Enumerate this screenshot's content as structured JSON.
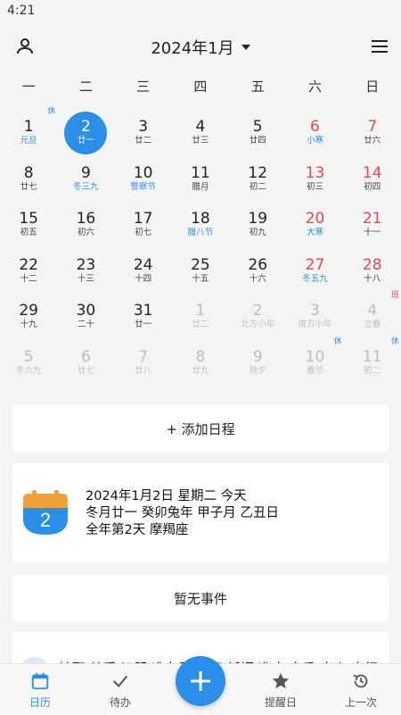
{
  "status": {
    "time": "4:21"
  },
  "header": {
    "title": "2024年1月"
  },
  "weekdays": [
    "一",
    "二",
    "三",
    "四",
    "五",
    "六",
    "日"
  ],
  "calendar": {
    "rows": [
      [
        {
          "n": "1",
          "s": "元旦",
          "f": true,
          "b": "休",
          "bt": "rest"
        },
        {
          "n": "2",
          "s": "廿一",
          "sel": true
        },
        {
          "n": "3",
          "s": "廿二"
        },
        {
          "n": "4",
          "s": "廿三"
        },
        {
          "n": "5",
          "s": "廿四"
        },
        {
          "n": "6",
          "s": "小寒",
          "f": true,
          "w": true
        },
        {
          "n": "7",
          "s": "廿六",
          "w": true
        }
      ],
      [
        {
          "n": "8",
          "s": "廿七"
        },
        {
          "n": "9",
          "s": "冬三九",
          "f": true
        },
        {
          "n": "10",
          "s": "警察节",
          "f": true
        },
        {
          "n": "11",
          "s": "腊月"
        },
        {
          "n": "12",
          "s": "初二"
        },
        {
          "n": "13",
          "s": "初三",
          "w": true
        },
        {
          "n": "14",
          "s": "初四",
          "w": true
        }
      ],
      [
        {
          "n": "15",
          "s": "初五"
        },
        {
          "n": "16",
          "s": "初六"
        },
        {
          "n": "17",
          "s": "初七"
        },
        {
          "n": "18",
          "s": "腊八节",
          "f": true
        },
        {
          "n": "19",
          "s": "初九"
        },
        {
          "n": "20",
          "s": "大寒",
          "f": true,
          "w": true
        },
        {
          "n": "21",
          "s": "十一",
          "w": true
        }
      ],
      [
        {
          "n": "22",
          "s": "十二"
        },
        {
          "n": "23",
          "s": "十三"
        },
        {
          "n": "24",
          "s": "十四"
        },
        {
          "n": "25",
          "s": "十五"
        },
        {
          "n": "26",
          "s": "十六"
        },
        {
          "n": "27",
          "s": "冬五九",
          "f": true,
          "w": true
        },
        {
          "n": "28",
          "s": "十八",
          "w": true
        }
      ],
      [
        {
          "n": "29",
          "s": "十九"
        },
        {
          "n": "30",
          "s": "二十"
        },
        {
          "n": "31",
          "s": "廿一"
        },
        {
          "n": "1",
          "s": "廿二",
          "o": true
        },
        {
          "n": "2",
          "s": "北方小年",
          "o": true
        },
        {
          "n": "3",
          "s": "南方小年",
          "o": true
        },
        {
          "n": "4",
          "s": "立春",
          "o": true,
          "b": "班",
          "bt": "work"
        }
      ],
      [
        {
          "n": "5",
          "s": "冬六九",
          "o": true
        },
        {
          "n": "6",
          "s": "廿七",
          "o": true
        },
        {
          "n": "7",
          "s": "廿八",
          "o": true
        },
        {
          "n": "8",
          "s": "廿九",
          "o": true
        },
        {
          "n": "9",
          "s": "除夕",
          "o": true
        },
        {
          "n": "10",
          "s": "春节",
          "o": true,
          "b": "休",
          "bt": "rest"
        },
        {
          "n": "11",
          "s": "初二",
          "o": true,
          "b": "休",
          "bt": "rest"
        }
      ]
    ]
  },
  "add_schedule": "+ 添加日程",
  "info": {
    "icon_day": "2",
    "line1": "2024年1月2日 星期二 今天",
    "line2": "冬月廿一 癸卯兔年 甲子月 乙丑日",
    "line3": "全年第2天 摩羯座"
  },
  "no_event": "暂无事件",
  "yi_text": "嫁娶 纳采 订盟 造车器 祭祀 祈福 造庙 安香 出火 出行",
  "tabs": {
    "calendar": "日历",
    "todo": "待办",
    "reminder": "提醒日",
    "previous": "上一次"
  },
  "colors": {
    "accent": "#2b8ee8",
    "weekend": "#e0494d",
    "muted": "#bdbdbd",
    "icon_orange": "#f0a23a"
  }
}
